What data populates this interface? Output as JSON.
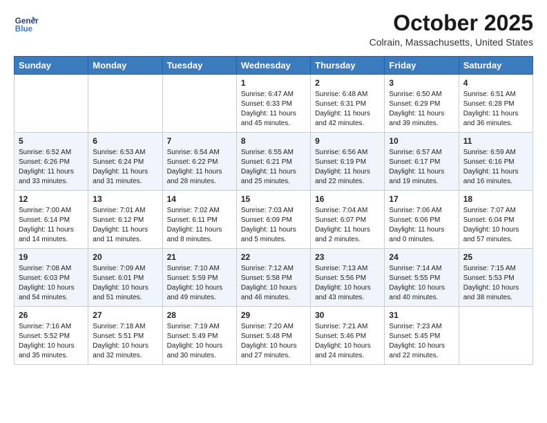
{
  "header": {
    "logo_line1": "General",
    "logo_line2": "Blue",
    "month_title": "October 2025",
    "location": "Colrain, Massachusetts, United States"
  },
  "weekdays": [
    "Sunday",
    "Monday",
    "Tuesday",
    "Wednesday",
    "Thursday",
    "Friday",
    "Saturday"
  ],
  "weeks": [
    [
      {
        "day": "",
        "sunrise": "",
        "sunset": "",
        "daylight": ""
      },
      {
        "day": "",
        "sunrise": "",
        "sunset": "",
        "daylight": ""
      },
      {
        "day": "",
        "sunrise": "",
        "sunset": "",
        "daylight": ""
      },
      {
        "day": "1",
        "sunrise": "Sunrise: 6:47 AM",
        "sunset": "Sunset: 6:33 PM",
        "daylight": "Daylight: 11 hours and 45 minutes."
      },
      {
        "day": "2",
        "sunrise": "Sunrise: 6:48 AM",
        "sunset": "Sunset: 6:31 PM",
        "daylight": "Daylight: 11 hours and 42 minutes."
      },
      {
        "day": "3",
        "sunrise": "Sunrise: 6:50 AM",
        "sunset": "Sunset: 6:29 PM",
        "daylight": "Daylight: 11 hours and 39 minutes."
      },
      {
        "day": "4",
        "sunrise": "Sunrise: 6:51 AM",
        "sunset": "Sunset: 6:28 PM",
        "daylight": "Daylight: 11 hours and 36 minutes."
      }
    ],
    [
      {
        "day": "5",
        "sunrise": "Sunrise: 6:52 AM",
        "sunset": "Sunset: 6:26 PM",
        "daylight": "Daylight: 11 hours and 33 minutes."
      },
      {
        "day": "6",
        "sunrise": "Sunrise: 6:53 AM",
        "sunset": "Sunset: 6:24 PM",
        "daylight": "Daylight: 11 hours and 31 minutes."
      },
      {
        "day": "7",
        "sunrise": "Sunrise: 6:54 AM",
        "sunset": "Sunset: 6:22 PM",
        "daylight": "Daylight: 11 hours and 28 minutes."
      },
      {
        "day": "8",
        "sunrise": "Sunrise: 6:55 AM",
        "sunset": "Sunset: 6:21 PM",
        "daylight": "Daylight: 11 hours and 25 minutes."
      },
      {
        "day": "9",
        "sunrise": "Sunrise: 6:56 AM",
        "sunset": "Sunset: 6:19 PM",
        "daylight": "Daylight: 11 hours and 22 minutes."
      },
      {
        "day": "10",
        "sunrise": "Sunrise: 6:57 AM",
        "sunset": "Sunset: 6:17 PM",
        "daylight": "Daylight: 11 hours and 19 minutes."
      },
      {
        "day": "11",
        "sunrise": "Sunrise: 6:59 AM",
        "sunset": "Sunset: 6:16 PM",
        "daylight": "Daylight: 11 hours and 16 minutes."
      }
    ],
    [
      {
        "day": "12",
        "sunrise": "Sunrise: 7:00 AM",
        "sunset": "Sunset: 6:14 PM",
        "daylight": "Daylight: 11 hours and 14 minutes."
      },
      {
        "day": "13",
        "sunrise": "Sunrise: 7:01 AM",
        "sunset": "Sunset: 6:12 PM",
        "daylight": "Daylight: 11 hours and 11 minutes."
      },
      {
        "day": "14",
        "sunrise": "Sunrise: 7:02 AM",
        "sunset": "Sunset: 6:11 PM",
        "daylight": "Daylight: 11 hours and 8 minutes."
      },
      {
        "day": "15",
        "sunrise": "Sunrise: 7:03 AM",
        "sunset": "Sunset: 6:09 PM",
        "daylight": "Daylight: 11 hours and 5 minutes."
      },
      {
        "day": "16",
        "sunrise": "Sunrise: 7:04 AM",
        "sunset": "Sunset: 6:07 PM",
        "daylight": "Daylight: 11 hours and 2 minutes."
      },
      {
        "day": "17",
        "sunrise": "Sunrise: 7:06 AM",
        "sunset": "Sunset: 6:06 PM",
        "daylight": "Daylight: 11 hours and 0 minutes."
      },
      {
        "day": "18",
        "sunrise": "Sunrise: 7:07 AM",
        "sunset": "Sunset: 6:04 PM",
        "daylight": "Daylight: 10 hours and 57 minutes."
      }
    ],
    [
      {
        "day": "19",
        "sunrise": "Sunrise: 7:08 AM",
        "sunset": "Sunset: 6:03 PM",
        "daylight": "Daylight: 10 hours and 54 minutes."
      },
      {
        "day": "20",
        "sunrise": "Sunrise: 7:09 AM",
        "sunset": "Sunset: 6:01 PM",
        "daylight": "Daylight: 10 hours and 51 minutes."
      },
      {
        "day": "21",
        "sunrise": "Sunrise: 7:10 AM",
        "sunset": "Sunset: 5:59 PM",
        "daylight": "Daylight: 10 hours and 49 minutes."
      },
      {
        "day": "22",
        "sunrise": "Sunrise: 7:12 AM",
        "sunset": "Sunset: 5:58 PM",
        "daylight": "Daylight: 10 hours and 46 minutes."
      },
      {
        "day": "23",
        "sunrise": "Sunrise: 7:13 AM",
        "sunset": "Sunset: 5:56 PM",
        "daylight": "Daylight: 10 hours and 43 minutes."
      },
      {
        "day": "24",
        "sunrise": "Sunrise: 7:14 AM",
        "sunset": "Sunset: 5:55 PM",
        "daylight": "Daylight: 10 hours and 40 minutes."
      },
      {
        "day": "25",
        "sunrise": "Sunrise: 7:15 AM",
        "sunset": "Sunset: 5:53 PM",
        "daylight": "Daylight: 10 hours and 38 minutes."
      }
    ],
    [
      {
        "day": "26",
        "sunrise": "Sunrise: 7:16 AM",
        "sunset": "Sunset: 5:52 PM",
        "daylight": "Daylight: 10 hours and 35 minutes."
      },
      {
        "day": "27",
        "sunrise": "Sunrise: 7:18 AM",
        "sunset": "Sunset: 5:51 PM",
        "daylight": "Daylight: 10 hours and 32 minutes."
      },
      {
        "day": "28",
        "sunrise": "Sunrise: 7:19 AM",
        "sunset": "Sunset: 5:49 PM",
        "daylight": "Daylight: 10 hours and 30 minutes."
      },
      {
        "day": "29",
        "sunrise": "Sunrise: 7:20 AM",
        "sunset": "Sunset: 5:48 PM",
        "daylight": "Daylight: 10 hours and 27 minutes."
      },
      {
        "day": "30",
        "sunrise": "Sunrise: 7:21 AM",
        "sunset": "Sunset: 5:46 PM",
        "daylight": "Daylight: 10 hours and 24 minutes."
      },
      {
        "day": "31",
        "sunrise": "Sunrise: 7:23 AM",
        "sunset": "Sunset: 5:45 PM",
        "daylight": "Daylight: 10 hours and 22 minutes."
      },
      {
        "day": "",
        "sunrise": "",
        "sunset": "",
        "daylight": ""
      }
    ]
  ]
}
